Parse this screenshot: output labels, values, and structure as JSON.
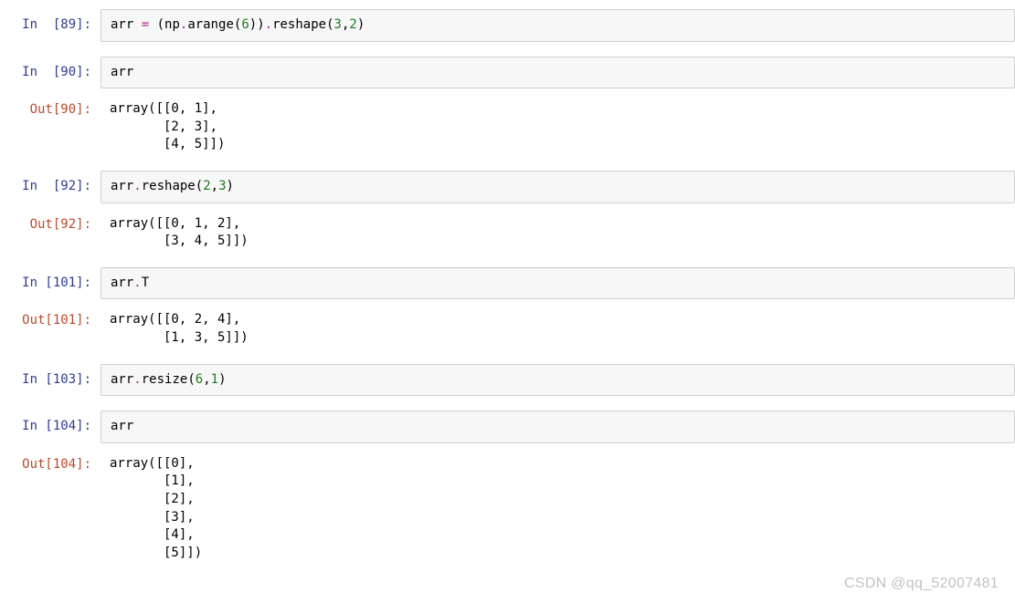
{
  "cells": [
    {
      "type": "in",
      "n": 89,
      "prompt": "In  [89]:",
      "tokens": [
        {
          "t": "arr ",
          "c": "tok-name"
        },
        {
          "t": "=",
          "c": "tok-op"
        },
        {
          "t": " (np",
          "c": "tok-name"
        },
        {
          "t": ".",
          "c": "tok-op"
        },
        {
          "t": "arange",
          "c": "tok-name"
        },
        {
          "t": "(",
          "c": "tok-paren"
        },
        {
          "t": "6",
          "c": "tok-num"
        },
        {
          "t": "))",
          "c": "tok-paren"
        },
        {
          "t": ".",
          "c": "tok-op"
        },
        {
          "t": "reshape",
          "c": "tok-name"
        },
        {
          "t": "(",
          "c": "tok-paren"
        },
        {
          "t": "3",
          "c": "tok-num"
        },
        {
          "t": ",",
          "c": "tok-paren"
        },
        {
          "t": "2",
          "c": "tok-num"
        },
        {
          "t": ")",
          "c": "tok-paren"
        }
      ]
    },
    {
      "type": "in",
      "n": 90,
      "prompt": "In  [90]:",
      "tokens": [
        {
          "t": "arr",
          "c": "tok-name"
        }
      ]
    },
    {
      "type": "out",
      "n": 90,
      "prompt": "Out[90]:",
      "text": "array([[0, 1],\n       [2, 3],\n       [4, 5]])"
    },
    {
      "type": "in",
      "n": 92,
      "prompt": "In  [92]:",
      "tokens": [
        {
          "t": "arr",
          "c": "tok-name"
        },
        {
          "t": ".",
          "c": "tok-op"
        },
        {
          "t": "reshape",
          "c": "tok-name"
        },
        {
          "t": "(",
          "c": "tok-paren"
        },
        {
          "t": "2",
          "c": "tok-num"
        },
        {
          "t": ",",
          "c": "tok-paren"
        },
        {
          "t": "3",
          "c": "tok-num"
        },
        {
          "t": ")",
          "c": "tok-paren"
        }
      ]
    },
    {
      "type": "out",
      "n": 92,
      "prompt": "Out[92]:",
      "text": "array([[0, 1, 2],\n       [3, 4, 5]])"
    },
    {
      "type": "in",
      "n": 101,
      "prompt": "In [101]:",
      "tokens": [
        {
          "t": "arr",
          "c": "tok-name"
        },
        {
          "t": ".",
          "c": "tok-op"
        },
        {
          "t": "T",
          "c": "tok-name"
        }
      ]
    },
    {
      "type": "out",
      "n": 101,
      "prompt": "Out[101]:",
      "text": "array([[0, 2, 4],\n       [1, 3, 5]])"
    },
    {
      "type": "in",
      "n": 103,
      "prompt": "In [103]:",
      "tokens": [
        {
          "t": "arr",
          "c": "tok-name"
        },
        {
          "t": ".",
          "c": "tok-op"
        },
        {
          "t": "resize",
          "c": "tok-name"
        },
        {
          "t": "(",
          "c": "tok-paren"
        },
        {
          "t": "6",
          "c": "tok-num"
        },
        {
          "t": ",",
          "c": "tok-paren"
        },
        {
          "t": "1",
          "c": "tok-num"
        },
        {
          "t": ")",
          "c": "tok-paren"
        }
      ]
    },
    {
      "type": "in",
      "n": 104,
      "prompt": "In [104]:",
      "tokens": [
        {
          "t": "arr",
          "c": "tok-name"
        }
      ]
    },
    {
      "type": "out",
      "n": 104,
      "prompt": "Out[104]:",
      "text": "array([[0],\n       [1],\n       [2],\n       [3],\n       [4],\n       [5]])"
    }
  ],
  "watermark": "CSDN @qq_52007481"
}
